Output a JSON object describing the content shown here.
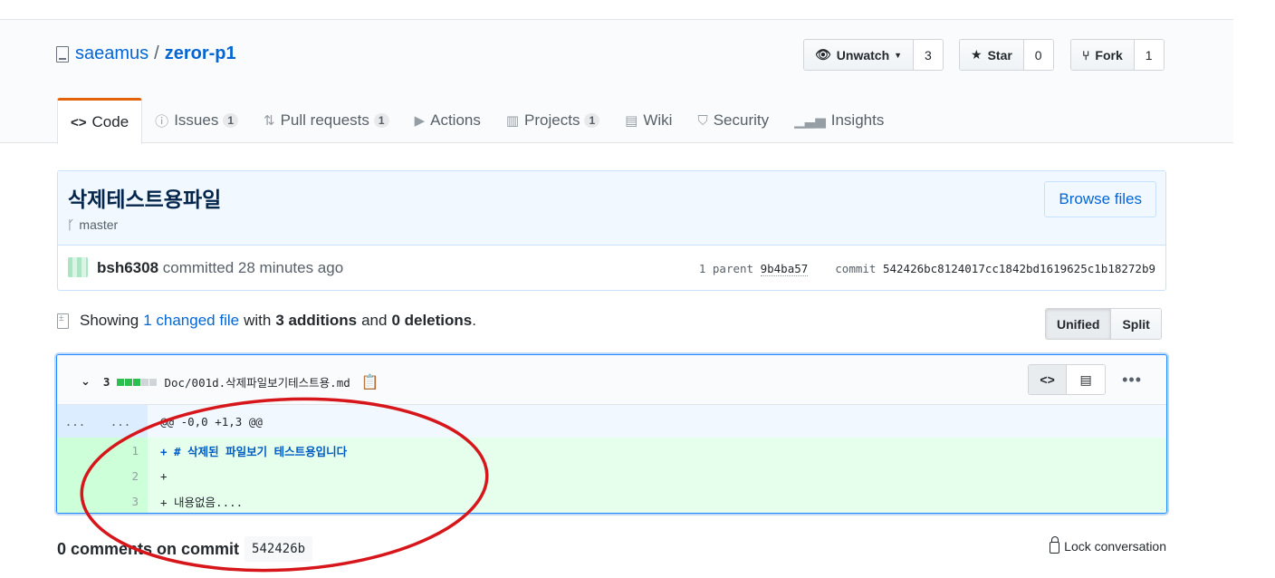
{
  "repo": {
    "owner": "saeamus",
    "separator": "/",
    "name": "zeror-p1"
  },
  "actions": {
    "watch": {
      "label": "Unwatch",
      "count": "3"
    },
    "star": {
      "label": "Star",
      "count": "0"
    },
    "fork": {
      "label": "Fork",
      "count": "1"
    }
  },
  "tabs": [
    {
      "label": "Code",
      "icon": "code-icon"
    },
    {
      "label": "Issues",
      "counter": "1",
      "icon": "issue-icon"
    },
    {
      "label": "Pull requests",
      "counter": "1",
      "icon": "pull-request-icon"
    },
    {
      "label": "Actions",
      "icon": "play-icon"
    },
    {
      "label": "Projects",
      "counter": "1",
      "icon": "project-icon"
    },
    {
      "label": "Wiki",
      "icon": "book-icon"
    },
    {
      "label": "Security",
      "icon": "shield-icon"
    },
    {
      "label": "Insights",
      "icon": "graph-icon"
    }
  ],
  "commit": {
    "title": "삭제테스트용파일",
    "branch": "master",
    "browse_label": "Browse files",
    "author": "bsh6308",
    "action": "committed 28 minutes ago",
    "parent_label": "1 parent",
    "parent_sha": "9b4ba57",
    "commit_label": "commit",
    "sha": "542426bc8124017cc1842bd1619625c1b18272b9"
  },
  "toc": {
    "showing": "Showing",
    "changed": "1 changed file",
    "with": "with",
    "additions": "3 additions",
    "and": "and",
    "deletions": "0 deletions",
    "end": "."
  },
  "view_toggle": {
    "unified": "Unified",
    "split": "Split"
  },
  "file": {
    "change_count": "3",
    "path": "Doc/001d.삭제파일보기테스트용.md",
    "hunk_old": "...",
    "hunk_new": "...",
    "hunk_header": "@@ -0,0 +1,3 @@",
    "lines": [
      {
        "num": "1",
        "text": "+ # 삭제된 파일보기 테스트용입니다"
      },
      {
        "num": "2",
        "text": "+"
      },
      {
        "num": "3",
        "text": "+ 내용없음...."
      }
    ]
  },
  "comments": {
    "label": "0 comments on commit",
    "sha": "542426b"
  },
  "lock_label": "Lock conversation",
  "colors": {
    "accent": "#0366d6",
    "tab_highlight": "#e36209",
    "add_bg": "#e6ffed",
    "annotation": "#d6161a"
  }
}
